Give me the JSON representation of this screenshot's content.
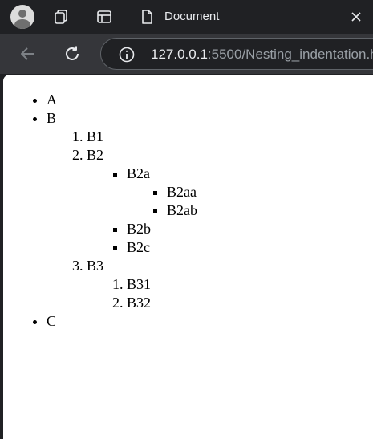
{
  "tab": {
    "title": "Document"
  },
  "address_bar": {
    "host": "127.0.0.1",
    "rest": ":5500/Nesting_indentation.h"
  },
  "content": {
    "item_a": "A",
    "item_b": "B",
    "b1": "B1",
    "b2": "B2",
    "b2a": "B2a",
    "b2aa": "B2aa",
    "b2ab": "B2ab",
    "b2b": "B2b",
    "b2c": "B2c",
    "b3": "B3",
    "b31": "B31",
    "b32": "B32",
    "item_c": "C"
  }
}
